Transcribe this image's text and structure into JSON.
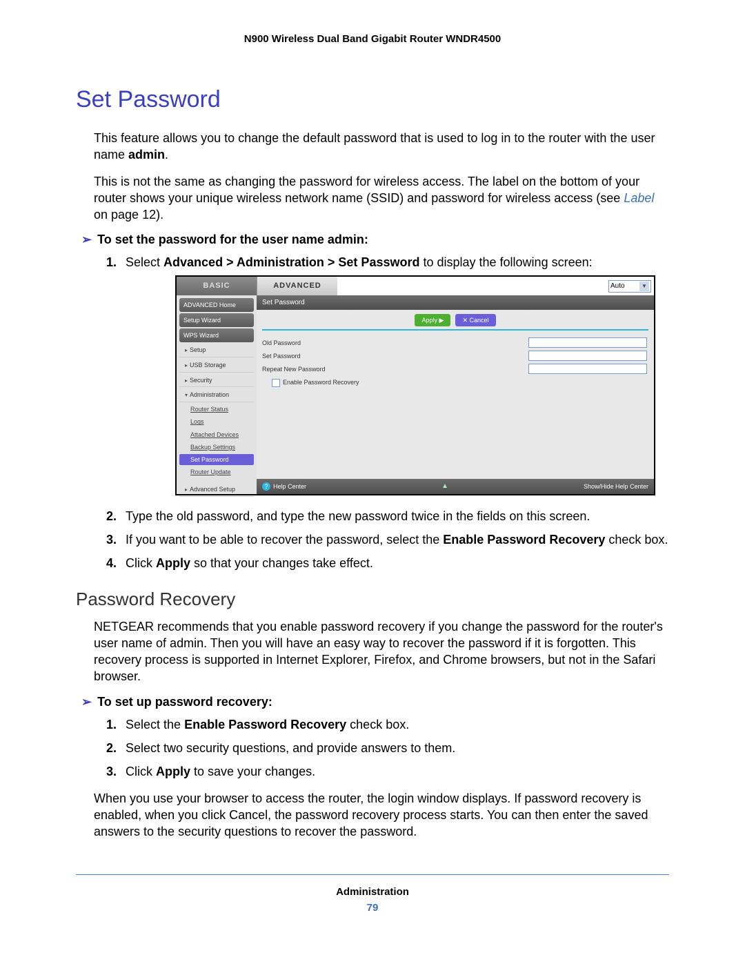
{
  "header": {
    "product": "N900 Wireless Dual Band Gigabit Router WNDR4500"
  },
  "section": {
    "title": "Set Password",
    "p1a": "This feature allows you to change the default password that is used to log in to the router with the user name ",
    "p1_bold": "admin",
    "p1b": ".",
    "p2a": "This is not the same as changing the password for wireless access. The label on the bottom of your router shows your unique wireless network name (SSID) and password for wireless access (see ",
    "p2_link": "Label",
    "p2b": " on page 12).",
    "task1_label": "To set the password for the user name admin:",
    "steps1": {
      "s1a": "Select ",
      "s1_bold": "Advanced > Administration > Set Password",
      "s1b": " to display the following screen:",
      "s2": "Type the old password, and type the new password twice in the fields on this screen.",
      "s3a": "If you want to be able to recover the password, select the ",
      "s3_bold": "Enable Password Recovery",
      "s3b": " check box.",
      "s4a": "Click ",
      "s4_bold": "Apply",
      "s4b": " so that your changes take effect."
    }
  },
  "subsection": {
    "title": "Password Recovery",
    "p1": "NETGEAR recommends that you enable password recovery if you change the password for the router's user name of admin. Then you will have an easy way to recover the password if it is forgotten. This recovery process is supported in Internet Explorer, Firefox, and Chrome browsers, but not in the Safari browser.",
    "task_label": "To set up password recovery:",
    "steps": {
      "s1a": "Select the ",
      "s1_bold": "Enable Password Recovery",
      "s1b": " check box.",
      "s2": "Select two security questions, and provide answers to them.",
      "s3a": "Click ",
      "s3_bold": "Apply",
      "s3b": " to save your changes."
    },
    "p2": "When you use your browser to access the router, the login window displays. If password recovery is enabled, when you click Cancel, the password recovery process starts. You can then enter the saved answers to the security questions to recover the password."
  },
  "router_ui": {
    "tabs": {
      "basic": "BASIC",
      "advanced": "ADVANCED"
    },
    "auto_label": "Auto",
    "side": {
      "home": "ADVANCED Home",
      "setup_wizard": "Setup Wizard",
      "wps_wizard": "WPS Wizard",
      "setup": "Setup",
      "usb": "USB Storage",
      "security": "Security",
      "administration": "Administration",
      "subs": {
        "router_status": "Router Status",
        "logs": "Logs",
        "attached": "Attached Devices",
        "backup": "Backup Settings",
        "set_password": "Set Password",
        "router_update": "Router Update"
      },
      "adv_setup": "Advanced Setup"
    },
    "panel": {
      "title": "Set Password",
      "apply_btn": "Apply ▶",
      "cancel_btn": "✕ Cancel",
      "old_pw": "Old Password",
      "set_pw": "Set Password",
      "repeat_pw": "Repeat New Password",
      "enable_recovery": "Enable Password Recovery"
    },
    "footer": {
      "help": "Help Center",
      "showhide": "Show/Hide Help Center"
    }
  },
  "page_footer": {
    "chapter": "Administration",
    "page_number": "79"
  },
  "glyphs": {
    "task_arrow": "➢"
  }
}
